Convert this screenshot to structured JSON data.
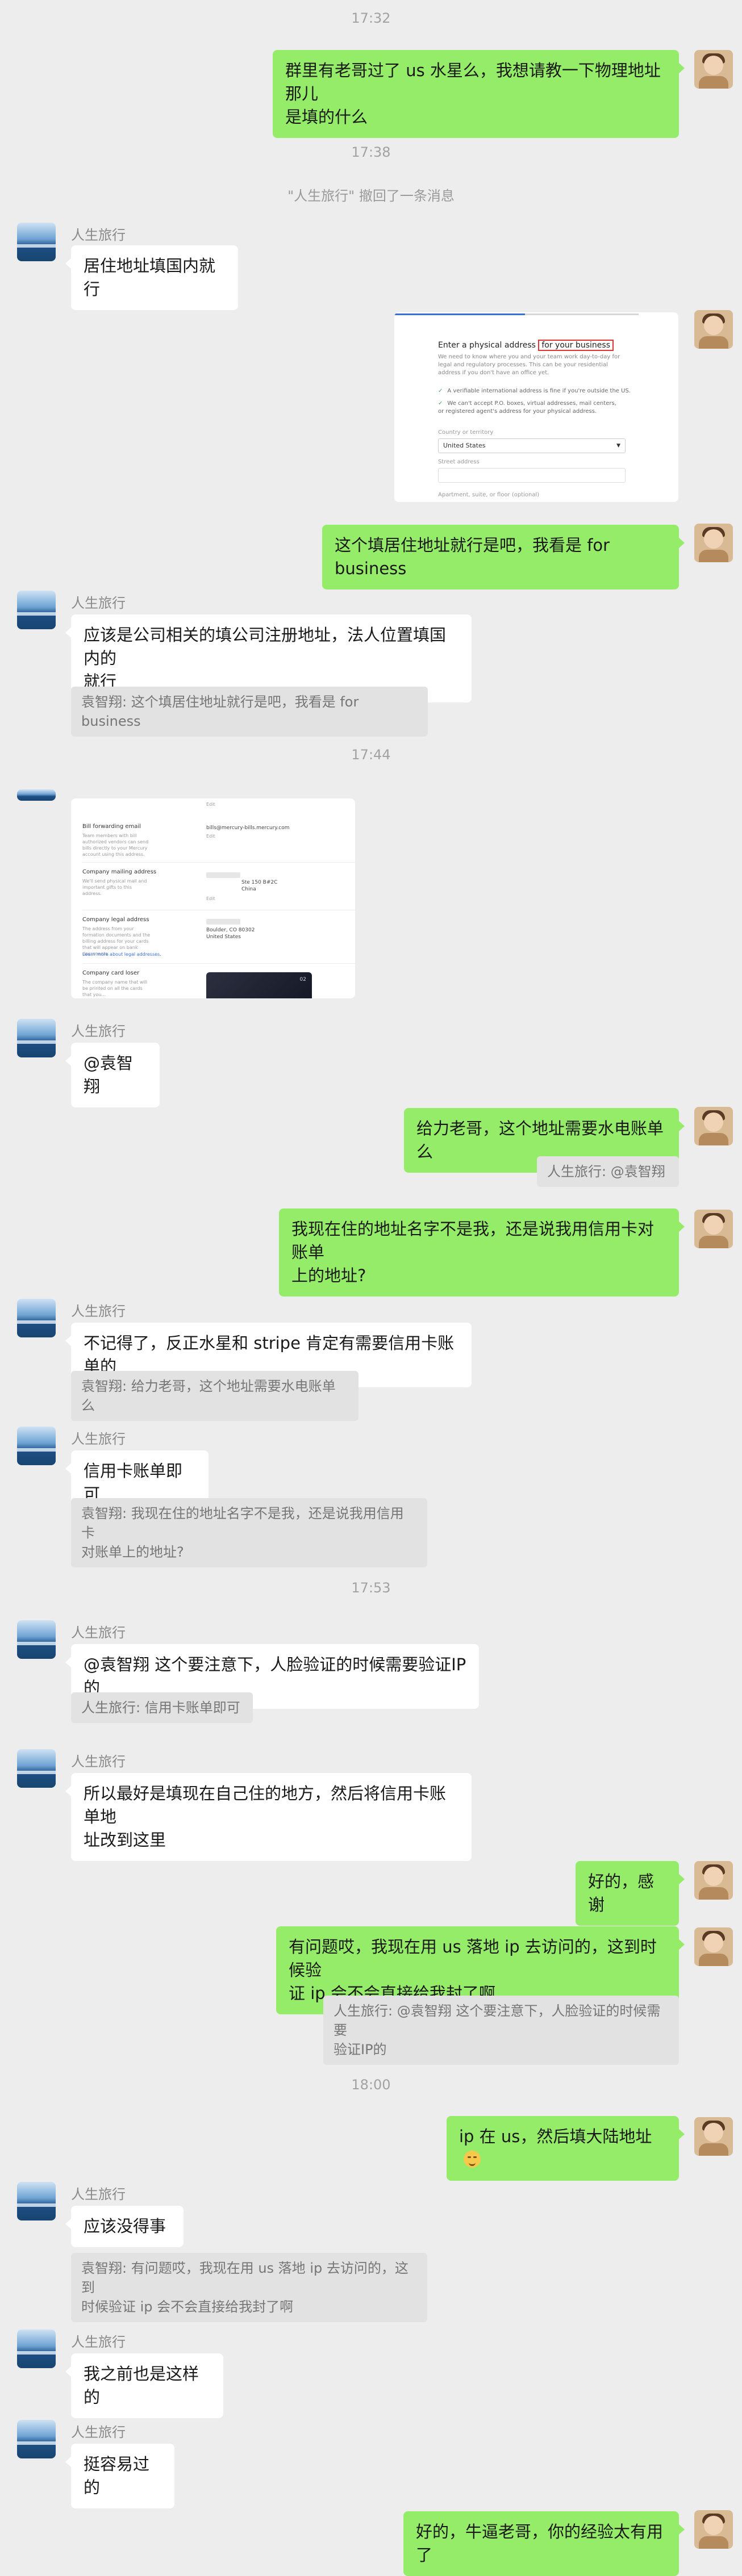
{
  "timestamps": [
    "17:32",
    "17:38",
    "17:44",
    "17:53",
    "18:00"
  ],
  "system_notice": "\"人生旅行\" 撤回了一条消息",
  "messages": [
    {
      "from": "self",
      "text": "群里有老哥过了 us 水星么，我想请教一下物理地址那儿\n是填的什么"
    },
    {
      "from": "other",
      "sender": "人生旅行",
      "text": "居住地址填国内就行"
    },
    {
      "from": "self",
      "type": "image"
    },
    {
      "from": "self",
      "text": "这个填居住地址就行是吧，我看是 for business"
    },
    {
      "from": "other",
      "sender": "人生旅行",
      "text": "应该是公司相关的填公司注册地址，法人位置填国内的\n就行",
      "quote": "袁智翔: 这个填居住地址就行是吧，我看是 for business"
    },
    {
      "from": "other",
      "type": "image"
    },
    {
      "from": "other",
      "sender": "人生旅行",
      "text": "@袁智翔"
    },
    {
      "from": "self",
      "text": "给力老哥，这个地址需要水电账单么",
      "quote": "人生旅行: @袁智翔"
    },
    {
      "from": "self",
      "text": "我现在住的地址名字不是我，还是说我用信用卡对账单\n上的地址?"
    },
    {
      "from": "other",
      "sender": "人生旅行",
      "text": "不记得了，反正水星和 stripe 肯定有需要信用卡账单的",
      "quote": "袁智翔: 给力老哥，这个地址需要水电账单么"
    },
    {
      "from": "other",
      "sender": "人生旅行",
      "text": "信用卡账单即可",
      "quote": "袁智翔: 我现在住的地址名字不是我，还是说我用信用卡\n对账单上的地址?"
    },
    {
      "from": "other",
      "sender": "人生旅行",
      "text": "@袁智翔 这个要注意下，人脸验证的时候需要验证IP的",
      "quote": "人生旅行: 信用卡账单即可"
    },
    {
      "from": "other",
      "sender": "人生旅行",
      "text": "所以最好是填现在自己住的地方，然后将信用卡账单地\n址改到这里"
    },
    {
      "from": "self",
      "text": "好的，感谢"
    },
    {
      "from": "self",
      "text": "有问题哎，我现在用 us 落地 ip 去访问的，这到时候验\n证 ip 会不会直接给我封了啊",
      "quote": "人生旅行: @袁智翔 这个要注意下，人脸验证的时候需要\n验证IP的"
    },
    {
      "from": "self",
      "text": "ip 在 us，然后填大陆地址",
      "emoji": "grinning-face-emoji"
    },
    {
      "from": "other",
      "sender": "人生旅行",
      "text": "应该没得事",
      "quote": "袁智翔: 有问题哎，我现在用 us 落地 ip 去访问的，这到\n时候验证 ip 会不会直接给我封了啊"
    },
    {
      "from": "other",
      "sender": "人生旅行",
      "text": "我之前也是这样的"
    },
    {
      "from": "other",
      "sender": "人生旅行",
      "text": "挺容易过的"
    },
    {
      "from": "self",
      "text": "好的，牛逼老哥，你的经验太有用了"
    }
  ],
  "screenshot1": {
    "title_prefix": "Enter a physical address ",
    "title_highlight": "for your business",
    "description": "We need to know where you and your team work day-to-day for legal and regulatory processes. This can be your residential address if you don't have an office yet.",
    "bullets": [
      "A verifiable international address is fine if you're outside the US.",
      "We can't accept P.O. boxes, virtual addresses, mail centers, or registered agent's address for your physical address."
    ],
    "country_label": "Country or territory",
    "country_value": "United States",
    "street_label": "Street address",
    "apartment_label": "Apartment, suite, or floor (optional)"
  },
  "screenshot2": {
    "rows": [
      {
        "title": "Bill forwarding email",
        "desc": "Team members with bill authorized vendors can send bills directly to your Mercury account using this address.",
        "value": "bills@mercury-bills.mercury.com"
      },
      {
        "title": "Company mailing address",
        "desc": "We'll send physical mail and important gifts to this address.",
        "value": "Ste 150 B#2C\nChina"
      },
      {
        "title": "Company legal address",
        "desc": "The address from your formation documents and the billing address for your cards that will appear on bank documents.",
        "value": "Boulder, CO 80302\nUnited States",
        "link": "Learn more about legal addresses."
      },
      {
        "title": "Company card loser",
        "desc": "The company name that will be printed on all the cards that you...",
        "value": ""
      }
    ],
    "edit_label": "Edit",
    "card_number": "02"
  }
}
